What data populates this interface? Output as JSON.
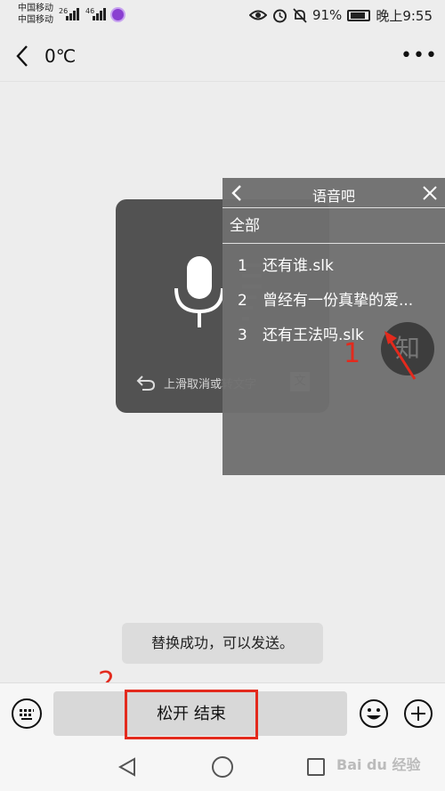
{
  "status_bar": {
    "carrier_1": "中国移动",
    "carrier_2": "中国移动",
    "network_1": "26",
    "network_2": "46",
    "battery": "91%",
    "time": "晚上9:55",
    "icons": [
      "eye-icon",
      "alarm-icon",
      "mute-icon",
      "battery-icon"
    ]
  },
  "header": {
    "title": "0℃",
    "more": "•••"
  },
  "recording_overlay": {
    "hint": "上滑取消或转文字",
    "convert_label": "文"
  },
  "voice_panel": {
    "title": "语音吧",
    "all_label": "全部",
    "files": [
      {
        "num": "1",
        "name": "还有谁.slk"
      },
      {
        "num": "2",
        "name": "曾经有一份真挚的爱..."
      },
      {
        "num": "3",
        "name": "还有王法吗.slk"
      }
    ]
  },
  "floating_button": {
    "label": "知"
  },
  "annotations": {
    "step_1": "1",
    "step_2": "2",
    "color": "#e32a1d"
  },
  "toast": {
    "text": "替换成功，可以发送。"
  },
  "input_bar": {
    "hold_to_talk_label": "松开 结束"
  },
  "watermark": "Bai du 经验"
}
